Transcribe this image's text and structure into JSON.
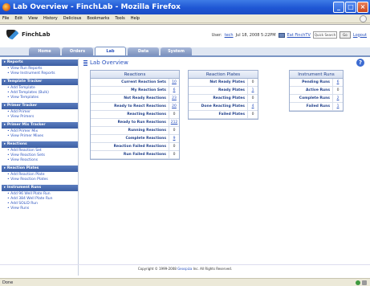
{
  "window": {
    "title": "Lab Overview - FinchLab - Mozilla Firefox"
  },
  "menu": [
    "File",
    "Edit",
    "View",
    "History",
    "Delicious",
    "Bookmarks",
    "Tools",
    "Help"
  ],
  "header": {
    "logo_text": "FinchLab",
    "user_label": "User:",
    "user_name": "tech",
    "date_text": "Jul 18, 2008 5:22PM",
    "eat_link": "Eat FinchTV",
    "quick_search_placeholder": "Quick Search",
    "go_label": "Go",
    "logout_label": "Logout"
  },
  "tabs": [
    {
      "label": "Home",
      "active": false
    },
    {
      "label": "Orders",
      "active": false
    },
    {
      "label": "Lab",
      "active": true
    },
    {
      "label": "Data",
      "active": false
    },
    {
      "label": "System",
      "active": false
    }
  ],
  "sidebar": [
    {
      "title": "Reports",
      "items": [
        "View Run Reports",
        "View Instrument Reports"
      ]
    },
    {
      "title": "Template Tracker",
      "items": [
        "Add Template",
        "Add Templates (Bulk)",
        "View Templates"
      ]
    },
    {
      "title": "Primer Tracker",
      "items": [
        "Add Primer",
        "View Primers"
      ]
    },
    {
      "title": "Primer Mix Tracker",
      "items": [
        "Add Primer Mix",
        "View Primer Mixes"
      ]
    },
    {
      "title": "Reactions",
      "items": [
        "Add Reaction Set",
        "View Reaction Sets",
        "View Reactions"
      ]
    },
    {
      "title": "Reaction Plates",
      "items": [
        "Add Reaction Plate",
        "View Reaction Plates"
      ]
    },
    {
      "title": "Instrument Runs",
      "items": [
        "Add 96 Well Plate Run",
        "Add 384 Well Plate Run",
        "Add SOLiD Run",
        "View Runs"
      ]
    }
  ],
  "main": {
    "title": "Lab Overview",
    "reactions": {
      "title": "Reactions",
      "rows": [
        {
          "label": "Current Reaction Sets",
          "value": "10",
          "link": true
        },
        {
          "label": "My Reaction Sets",
          "value": "6",
          "link": true
        },
        {
          "label": "Not Ready Reactions",
          "value": "23",
          "link": true
        },
        {
          "label": "Ready to React Reactions",
          "value": "20",
          "link": true
        },
        {
          "label": "Reacting Reactions",
          "value": "0",
          "link": false
        },
        {
          "label": "Ready to Run Reactions",
          "value": "212",
          "link": true
        },
        {
          "label": "Running Reactions",
          "value": "0",
          "link": false
        },
        {
          "label": "Complete Reactions",
          "value": "9",
          "link": true
        },
        {
          "label": "Reaction Failed Reactions",
          "value": "0",
          "link": false
        },
        {
          "label": "Run Failed Reactions",
          "value": "0",
          "link": false
        }
      ]
    },
    "plates": {
      "title": "Reaction Plates",
      "rows": [
        {
          "label": "Not Ready Plates",
          "value": "0",
          "link": false
        },
        {
          "label": "Ready Plates",
          "value": "1",
          "link": true
        },
        {
          "label": "Reacting Plates",
          "value": "0",
          "link": false
        },
        {
          "label": "Done Reacting Plates",
          "value": "4",
          "link": true
        },
        {
          "label": "Failed Plates",
          "value": "0",
          "link": false
        }
      ]
    },
    "runs": {
      "title": "Instrument Runs",
      "rows": [
        {
          "label": "Pending Runs",
          "value": "6",
          "link": true
        },
        {
          "label": "Active Runs",
          "value": "0",
          "link": false
        },
        {
          "label": "Complete Runs",
          "value": "2",
          "link": true
        },
        {
          "label": "Failed Runs",
          "value": "1",
          "link": true
        }
      ]
    }
  },
  "footer": {
    "prefix": "Copyright © 1999-2008",
    "company": "Geospiza",
    "suffix": "Inc.  All Rights Reserved."
  },
  "status": {
    "text": "Done"
  },
  "colors": {
    "accent": "#2a52be",
    "titlebar": "#1f56d4",
    "section": "#3c5ea3"
  }
}
